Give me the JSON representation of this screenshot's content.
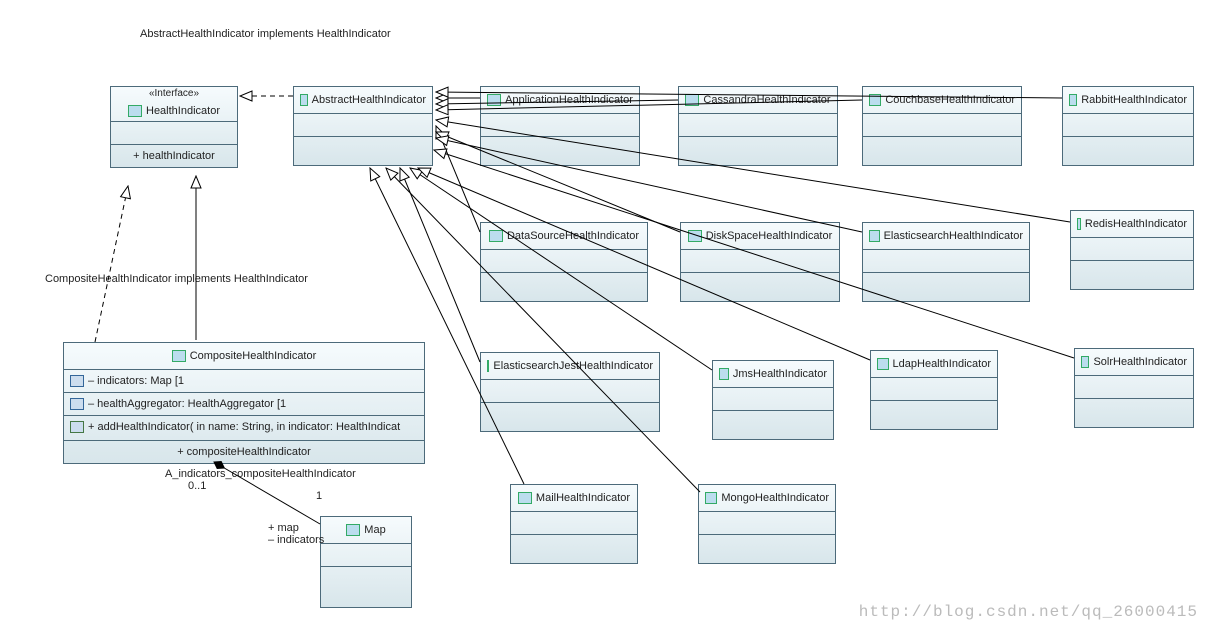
{
  "title_note": "AbstractHealthIndicator implements HealthIndicator",
  "note2": "CompositeHealthIndicator implements HealthIndicator",
  "watermark": "http://blog.csdn.net/qq_26000415",
  "healthIndicator": {
    "stereotype": "«Interface»",
    "name": "HealthIndicator",
    "op": "+ healthIndicator"
  },
  "abstract": {
    "name": "AbstractHealthIndicator"
  },
  "composite": {
    "name": "CompositeHealthIndicator",
    "attr1": "– indicators: Map [1",
    "attr2": "– healthAggregator: HealthAggregator [1",
    "op1": "+ addHealthIndicator(  in name: String,    in indicator: HealthIndicat",
    "op2": "+ compositeHealthIndicator"
  },
  "map": {
    "name": "Map"
  },
  "assoc": {
    "label": "A_indicators_compositeHealthIndicator",
    "mult_comp": "0..1",
    "mult_map": "1",
    "role_map": "+ map",
    "role_ind": "– indicators"
  },
  "impls": {
    "app": "ApplicationHealthIndicator",
    "cass": "CassandraHealthIndicator",
    "couch": "CouchbaseHealthIndicator",
    "rabbit": "RabbitHealthIndicator",
    "ds": "DataSourceHealthIndicator",
    "disk": "DiskSpaceHealthIndicator",
    "es": "ElasticsearchHealthIndicator",
    "redis": "RedisHealthIndicator",
    "esjest": "ElasticsearchJestHealthIndicator",
    "jms": "JmsHealthIndicator",
    "ldap": "LdapHealthIndicator",
    "solr": "SolrHealthIndicator",
    "mail": "MailHealthIndicator",
    "mongo": "MongoHealthIndicator"
  }
}
